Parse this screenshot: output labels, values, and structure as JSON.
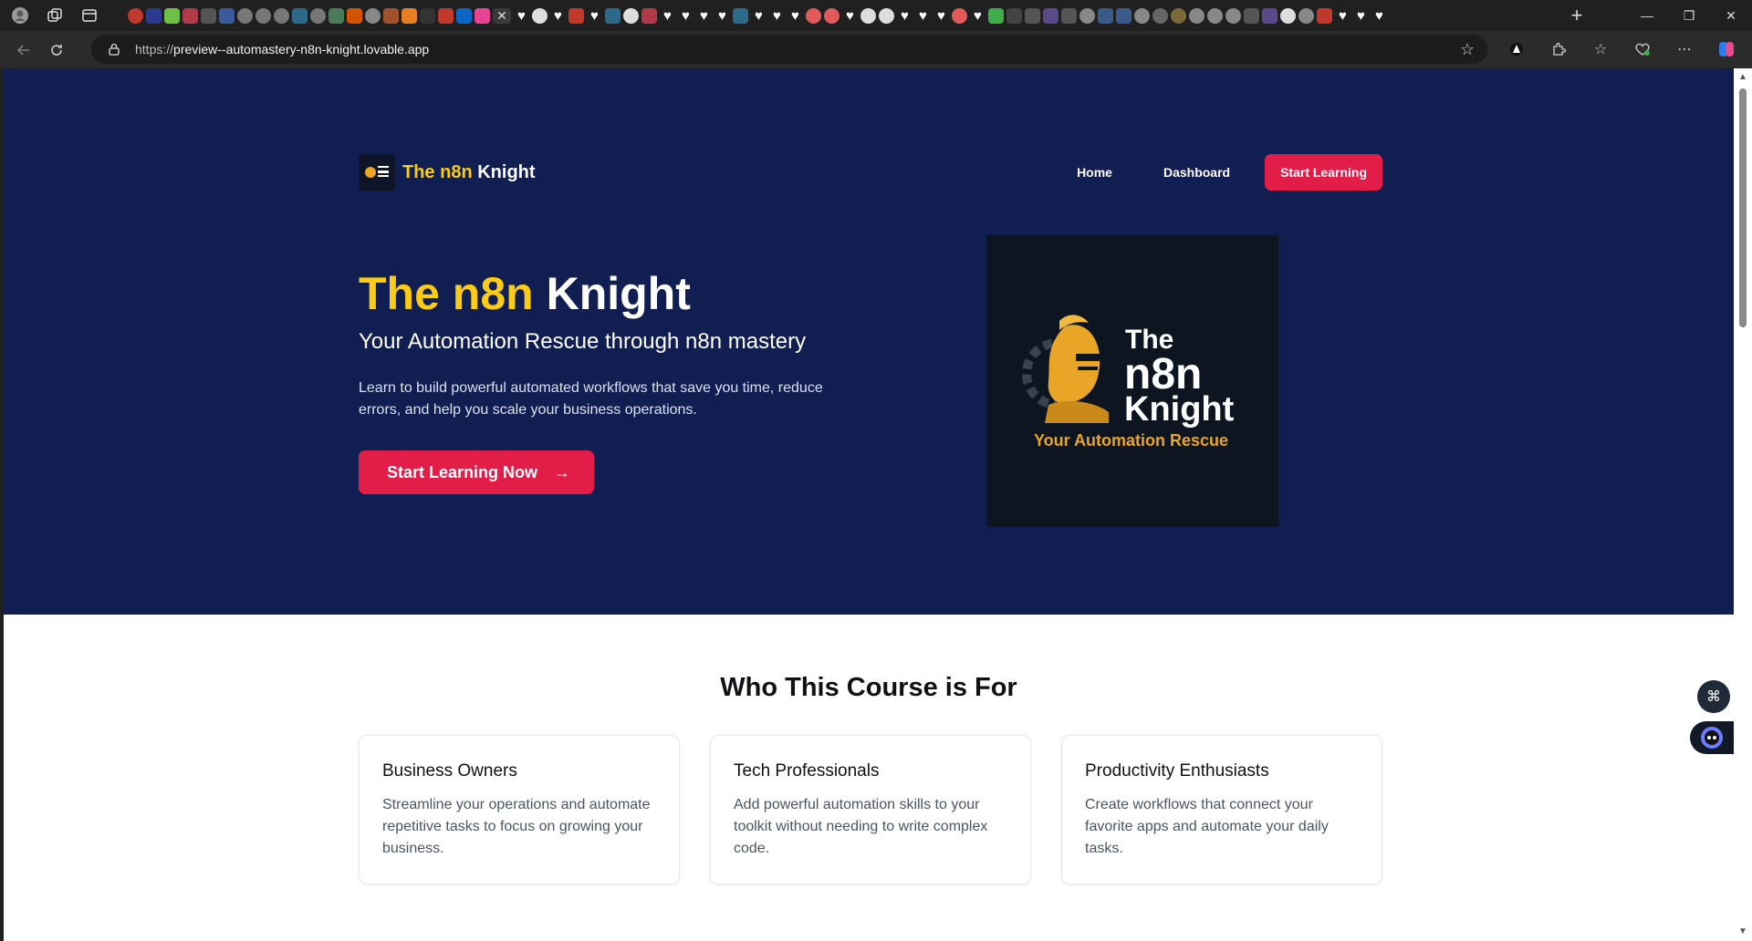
{
  "browser": {
    "url_prefix": "https://",
    "url_host": "preview--automastery-n8n-knight.lovable.app",
    "new_tab_label": "+",
    "window_controls": [
      "minimize-icon",
      "restore-icon",
      "close-icon"
    ],
    "toolbar_icons": [
      "ai-icon",
      "extensions-icon",
      "favorites-icon",
      "browser-essentials-icon",
      "more-icon",
      "copilot-icon"
    ]
  },
  "site": {
    "brand": {
      "part1": "The n8n",
      "part2": "Knight"
    },
    "nav": {
      "home": "Home",
      "dashboard": "Dashboard",
      "cta": "Start Learning"
    }
  },
  "hero": {
    "title_part1": "The n8n",
    "title_part2": "Knight",
    "subtitle": "Your Automation Rescue through n8n mastery",
    "description": "Learn to build powerful automated workflows that save you time, reduce errors, and help you scale your business operations.",
    "cta": "Start Learning Now",
    "cta_arrow": "→",
    "image": {
      "line1": "The",
      "line2": "n8n",
      "line3": "Knight",
      "tagline": "Your Automation Rescue"
    }
  },
  "audience": {
    "title": "Who This Course is For",
    "cards": [
      {
        "title": "Business Owners",
        "text": "Streamline your operations and automate repetitive tasks to focus on growing your business."
      },
      {
        "title": "Tech Professionals",
        "text": "Add powerful automation skills to your toolkit without needing to write complex code."
      },
      {
        "title": "Productivity Enthusiasts",
        "text": "Create workflows that connect your favorite apps and automate your daily tasks."
      }
    ]
  },
  "colors": {
    "hero_bg": "#111e52",
    "accent": "#e11d48",
    "gold": "#facc15",
    "logo_gold": "#e9a526"
  }
}
